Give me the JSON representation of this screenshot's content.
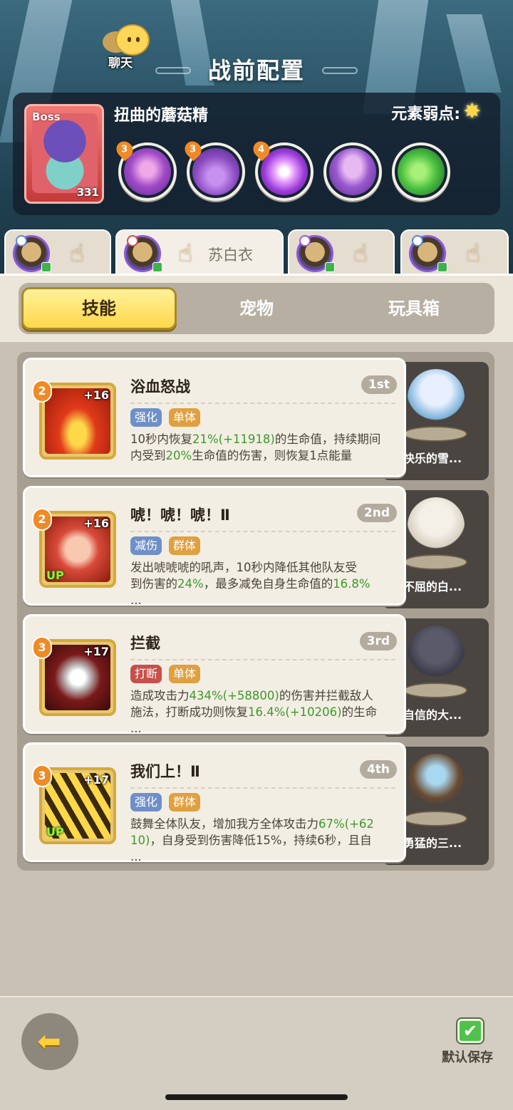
{
  "header": {
    "chat_label": "聊天",
    "title": "战前配置"
  },
  "boss": {
    "tag": "Boss",
    "level": "331",
    "name": "扭曲的蘑菇精",
    "weakness_label": "元素弱点:",
    "weakness_icon": "light-element-icon",
    "skills": [
      {
        "level": "3",
        "icon": "purple-swirl-skill-icon"
      },
      {
        "level": "3",
        "icon": "purple-drop-skill-icon"
      },
      {
        "level": "4",
        "icon": "glowing-mushroom-skill-icon"
      },
      {
        "level": "",
        "icon": "mushroom-skill-icon"
      },
      {
        "level": "",
        "icon": "green-slime-skill-icon"
      }
    ]
  },
  "heroes": {
    "tabs": [
      {
        "name": ""
      },
      {
        "name": "苏白衣"
      },
      {
        "name": ""
      },
      {
        "name": ""
      }
    ]
  },
  "segments": {
    "skill": "技能",
    "pet": "宠物",
    "toybox": "玩具箱"
  },
  "skills": [
    {
      "level": "2",
      "plus": "+16",
      "up": "",
      "title": "浴血怒战",
      "order": "1st",
      "tags": [
        "强化",
        "单体"
      ],
      "desc_parts": [
        "10秒内恢复",
        "21%(+11918)",
        "的生命值，持续期间\n内受到",
        "20%",
        "生命值的伤害，则恢复1点能量"
      ],
      "pet_name": "快乐的雪..."
    },
    {
      "level": "2",
      "plus": "+16",
      "up": "UP",
      "title": "唬！唬！唬！Ⅱ",
      "order": "2nd",
      "tags": [
        "减伤",
        "群体"
      ],
      "desc_parts": [
        "发出唬唬唬的吼声，10秒内降低其他队友受\n到伤害的",
        "24%",
        "，最多减免自身生命值的",
        "16.8%",
        "\n..."
      ],
      "pet_name": "不屈的白..."
    },
    {
      "level": "3",
      "plus": "+17",
      "up": "",
      "title": "拦截",
      "order": "3rd",
      "tags": [
        "打断",
        "单体"
      ],
      "desc_parts": [
        "造成攻击力",
        "434%(+58800)",
        "的伤害并拦截敌人\n施法，打断成功则恢复",
        "16.4%(+10206)",
        "的生命\n..."
      ],
      "pet_name": "自信的大..."
    },
    {
      "level": "3",
      "plus": "+17",
      "up": "UP",
      "title": "我们上！Ⅱ",
      "order": "4th",
      "tags": [
        "强化",
        "群体"
      ],
      "desc_parts": [
        "鼓舞全体队友，增加我方全体攻击力",
        "67%(+62\n10)",
        "，自身受到伤害降低15%，持续6秒，且自\n..."
      ],
      "pet_name": "勇猛的三..."
    }
  ],
  "footer": {
    "save_label": "默认保存",
    "save_checked": true
  },
  "colors": {
    "tag_强化": "#6f8fc8",
    "tag_单体": "#e0a040",
    "tag_群体": "#e0a040",
    "tag_减伤": "#6f8fc8",
    "tag_打断": "#c7504a",
    "highlight_green": "#3c9a2a",
    "level_badge": "#f08a24",
    "segment_active": "#ffd84a"
  }
}
